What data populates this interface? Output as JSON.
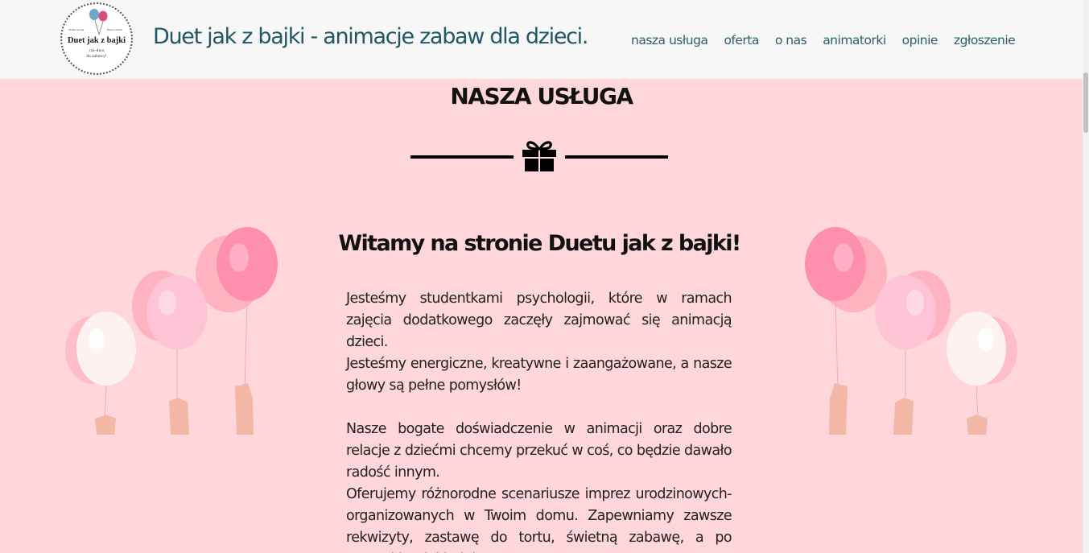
{
  "header": {
    "logo": {
      "name": "Duet jak z bajki",
      "left_small": "Monika Szostak",
      "right_small": "Barbara Szmidt",
      "tagline": [
        "raz-dwa",
        "do zabawy!"
      ]
    },
    "site_title": "Duet jak z bajki - animacje zabaw dla dzieci.",
    "nav": [
      "nasza usługa",
      "oferta",
      "o nas",
      "animatorki",
      "opinie",
      "zgłoszenie"
    ]
  },
  "main": {
    "section_title": "NASZA USŁUGA",
    "welcome": "Witamy na stronie Duetu jak z bajki!",
    "paragraphs": [
      "Jesteśmy studentkami psychologii, które w ramach zajęcia dodatkowego zaczęły zajmować się animacją dzieci.",
      "Jesteśmy energiczne, kreatywne i zaangażowane, a nasze głowy są pełne pomysłów!",
      "Nasze bogate doświadczenie w animacji oraz dobre relacje z dziećmi chcemy przekuć w coś, co będzie dawało radość innym.",
      "Oferujemy różnorodne scenariusze imprez urodzinowych-organizowanych w Twoim domu. Zapewniamy zawsze rekwizyty, zastawę do tortu, świetną zabawę, a po wszystkim dokładnie sprzątamy."
    ]
  },
  "colors": {
    "background": "#ffd6d9",
    "header_bg": "#f7f7f7",
    "title": "#1f5764",
    "nav": "#2a5d6a"
  },
  "icons": {
    "divider": "gift-icon",
    "logo": "balloons-icon"
  }
}
